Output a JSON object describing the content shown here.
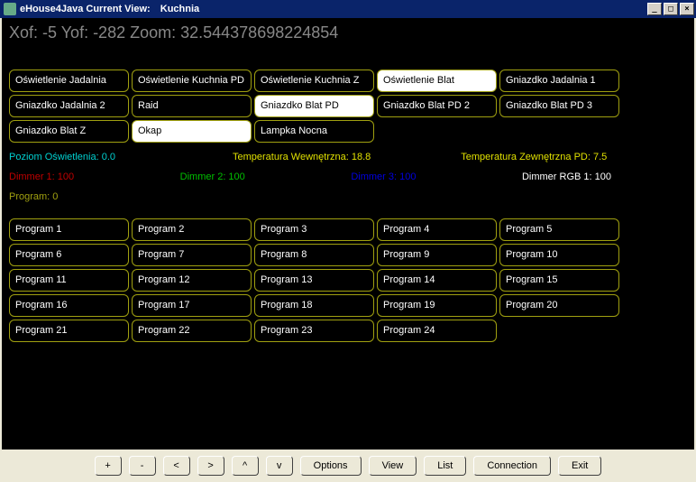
{
  "window": {
    "title_prefix": "eHouse4Java Current View:",
    "title_view": "Kuchnia"
  },
  "status": "Xof: -5 Yof: -282 Zoom: 32.544378698224854",
  "devices": [
    {
      "label": "Oświetlenie Jadalnia",
      "on": false
    },
    {
      "label": "Oświetlenie Kuchnia PD",
      "on": false
    },
    {
      "label": "Oświetlenie Kuchnia  Z",
      "on": false
    },
    {
      "label": "Oświetlenie Blat",
      "on": true
    },
    {
      "label": "Gniazdko Jadalnia 1",
      "on": false
    },
    {
      "label": "Gniazdko Jadalnia 2",
      "on": false
    },
    {
      "label": "Raid",
      "on": false
    },
    {
      "label": "Gniazdko Blat PD",
      "on": true
    },
    {
      "label": "Gniazdko Blat PD 2",
      "on": false
    },
    {
      "label": "Gniazdko Blat PD 3",
      "on": false
    },
    {
      "label": "Gniazdko Blat Z",
      "on": false
    },
    {
      "label": "Okap",
      "on": true
    },
    {
      "label": "Lampka Nocna",
      "on": false
    }
  ],
  "sensors": {
    "light_level_label": "Poziom Oświetlenia: 0.0",
    "temp_in_label": "Temperatura Wewnętrzna: 18.8",
    "temp_out_label": "Temperatura Zewnętrzna PD: 7.5"
  },
  "dimmers": {
    "d1": "Dimmer 1: 100",
    "d2": "Dimmer 2: 100",
    "d3": "Dimmer 3: 100",
    "rgb": "Dimmer RGB 1: 100"
  },
  "program_label": "Program: 0",
  "programs": [
    "Program 1",
    "Program 2",
    "Program 3",
    "Program 4",
    "Program 5",
    "Program 6",
    "Program 7",
    "Program 8",
    "Program 9",
    "Program 10",
    "Program 11",
    "Program 12",
    "Program 13",
    "Program 14",
    "Program 15",
    "Program 16",
    "Program 17",
    "Program 18",
    "Program 19",
    "Program 20",
    "Program 21",
    "Program 22",
    "Program 23",
    "Program 24"
  ],
  "toolbar": {
    "plus": "+",
    "minus": "-",
    "left": "<",
    "right": ">",
    "up": "^",
    "down": "v",
    "options": "Options",
    "view": "View",
    "list": "List",
    "connection": "Connection",
    "exit": "Exit"
  }
}
